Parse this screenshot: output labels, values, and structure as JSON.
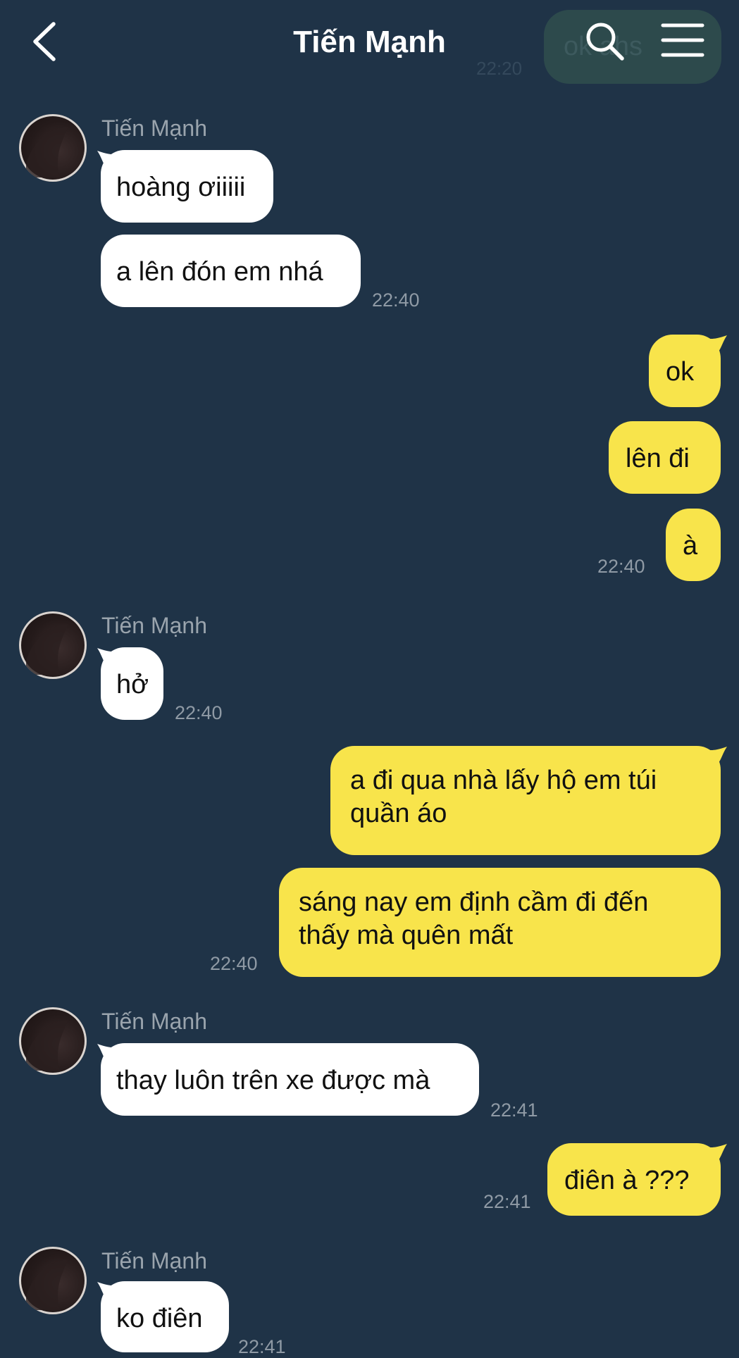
{
  "header": {
    "title": "Tiến Mạnh",
    "back_icon": "chevron-left-icon",
    "search_icon": "search-icon",
    "menu_icon": "hamburger-menu-icon"
  },
  "previous_message": {
    "text": "ok ahs",
    "time": "22:20"
  },
  "contact": {
    "name": "Tiến Mạnh"
  },
  "messages": [
    {
      "side": "in",
      "text": "hoàng ơiiiii"
    },
    {
      "side": "in",
      "text": "a lên đón em nhá",
      "time": "22:40"
    },
    {
      "side": "out",
      "text": "ok"
    },
    {
      "side": "out",
      "text": "lên đi"
    },
    {
      "side": "out",
      "text": "à",
      "time": "22:40"
    },
    {
      "side": "in",
      "text": "hở",
      "time": "22:40"
    },
    {
      "side": "out",
      "text": "a đi qua nhà lấy hộ em túi quần áo"
    },
    {
      "side": "out",
      "text": "sáng nay em định cầm đi đến thấy mà quên mất",
      "time": "22:40"
    },
    {
      "side": "in",
      "text": "thay luôn trên xe được mà",
      "time": "22:41"
    },
    {
      "side": "out",
      "text": "điên à ???",
      "time": "22:41"
    },
    {
      "side": "in",
      "text": "ko điên",
      "time": "22:41"
    }
  ],
  "colors": {
    "background": "#1f3347",
    "incoming_bubble": "#ffffff",
    "outgoing_bubble": "#f8e44b",
    "timestamp": "#8f9aa5",
    "sender_name": "#9aa4ad"
  }
}
